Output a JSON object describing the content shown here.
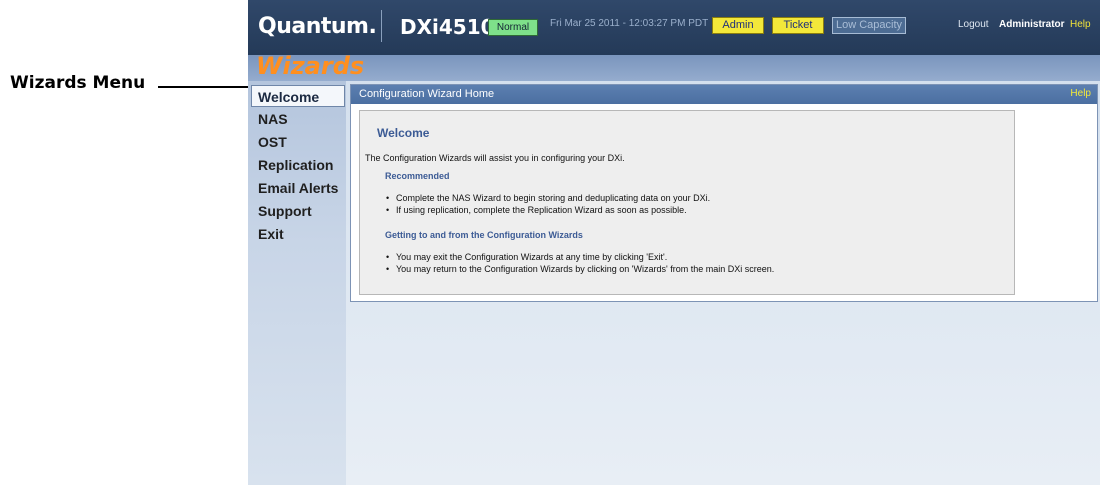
{
  "callout": {
    "label": "Wizards Menu"
  },
  "header": {
    "brand": "Quantum.",
    "model": "DXi4510",
    "status": "Normal",
    "datetime": "Fri Mar 25 2011 - 12:03:27 PM PDT",
    "admin_label": "Admin",
    "ticket_label": "Ticket",
    "low_capacity_label": "Low Capacity",
    "logout_label": "Logout",
    "user": "Administrator",
    "help_label": "Help"
  },
  "wizards": {
    "title": "Wizards"
  },
  "sidebar": {
    "items": [
      {
        "label": "Welcome",
        "active": true
      },
      {
        "label": "NAS"
      },
      {
        "label": "OST"
      },
      {
        "label": "Replication"
      },
      {
        "label": "Email Alerts"
      },
      {
        "label": "Support"
      },
      {
        "label": "Exit"
      }
    ]
  },
  "panel": {
    "title": "Configuration Wizard Home",
    "help_label": "Help",
    "welcome_heading": "Welcome",
    "intro": "The Configuration Wizards will assist you in configuring your DXi.",
    "recommended_heading": "Recommended",
    "recommended": [
      "Complete the NAS Wizard to begin storing and deduplicating data on your DXi.",
      "If using replication, complete the Replication Wizard as soon as possible."
    ],
    "getting_heading": "Getting to and from the Configuration Wizards",
    "getting": [
      "You may exit the Configuration Wizards at any time by clicking 'Exit'.",
      "You may return to the Configuration Wizards by clicking on 'Wizards' from the main DXi screen."
    ]
  },
  "colors": {
    "topbar": "#243a58",
    "accent_orange": "#ff8f1f",
    "status_green": "#7ee08a",
    "button_yellow": "#f3e83a",
    "heading_blue": "#3c5b95"
  }
}
